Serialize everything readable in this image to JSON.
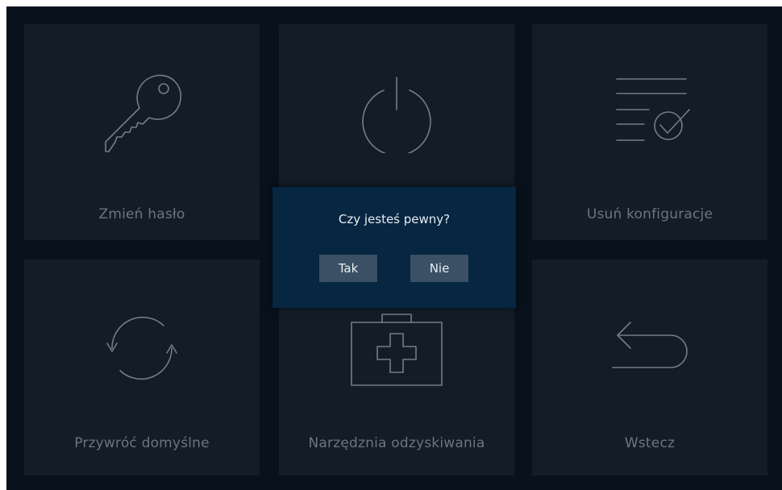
{
  "tiles": {
    "change_password": {
      "label": "Zmień hasło",
      "icon": "key-icon"
    },
    "power": {
      "label": "",
      "icon": "power-icon"
    },
    "delete_config": {
      "label": "Usuń konfiguracje",
      "icon": "document-check-icon"
    },
    "restore_defaults": {
      "label": "Przywróć domyślne",
      "icon": "refresh-icon"
    },
    "recovery_tools": {
      "label": "Narzędznia odzyskiwania",
      "icon": "first-aid-kit-icon"
    },
    "back": {
      "label": "Wstecz",
      "icon": "back-arrow-icon"
    }
  },
  "dialog": {
    "question": "Czy jesteś pewny?",
    "yes_label": "Tak",
    "no_label": "Nie"
  },
  "colors": {
    "background": "#07121c",
    "tile": "#121d27",
    "dialog": "#062641",
    "button": "#3b5064",
    "icon_stroke": "#757d84",
    "label_text": "#6c757d"
  }
}
